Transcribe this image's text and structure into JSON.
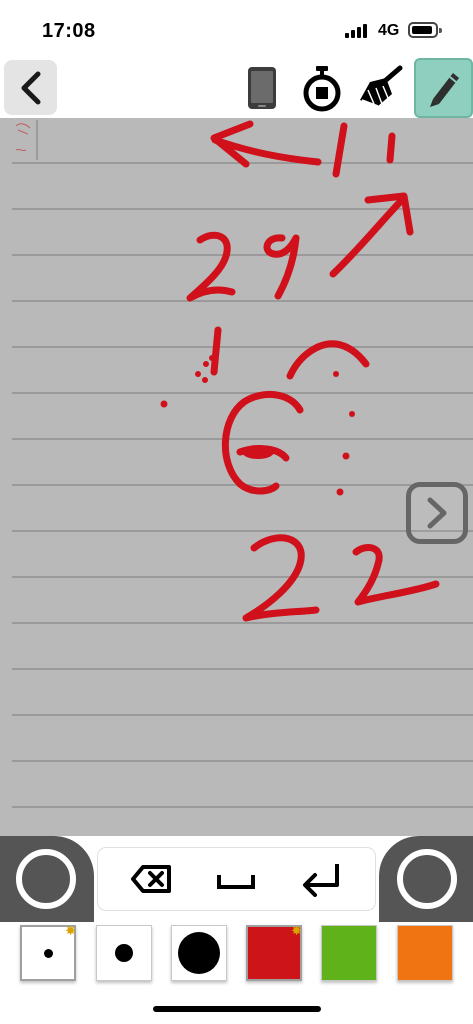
{
  "status_bar": {
    "time": "17:08",
    "network": "4G"
  },
  "toolbar": {
    "back_icon": "chevron-left-icon",
    "tools": [
      "phone-icon",
      "stopwatch-icon",
      "broom-icon",
      "pencil-icon"
    ],
    "active_tool": "pencil-icon",
    "active_color": "#8fcfc0"
  },
  "canvas": {
    "background_color": "#b9b9b9",
    "ruled_lines": true,
    "ink_color": "#d0101a"
  },
  "keys": {
    "backspace": "backspace-icon",
    "space": "space-icon",
    "enter": "enter-icon"
  },
  "palette": {
    "swatches": [
      {
        "name": "pen-size-small",
        "kind": "size",
        "selected": true
      },
      {
        "name": "pen-size-medium",
        "kind": "size",
        "selected": false
      },
      {
        "name": "pen-size-large",
        "kind": "size",
        "selected": false
      },
      {
        "name": "color-red",
        "kind": "color",
        "color": "#cc1419",
        "selected": true
      },
      {
        "name": "color-green",
        "kind": "color",
        "color": "#5fb21a",
        "selected": false
      },
      {
        "name": "color-orange",
        "kind": "color",
        "color": "#f07512",
        "selected": false
      }
    ]
  }
}
